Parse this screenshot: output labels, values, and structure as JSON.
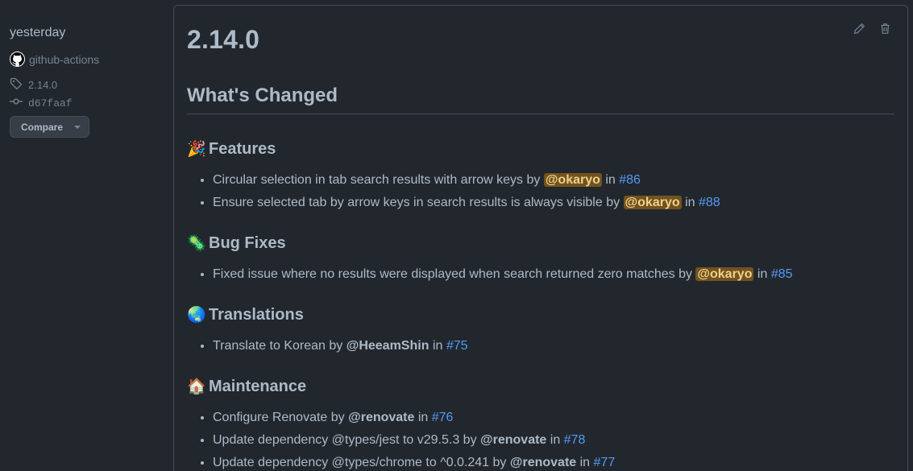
{
  "meta": {
    "date": "yesterday",
    "author": "github-actions",
    "tag": "2.14.0",
    "commit": "d67faaf",
    "compare_label": "Compare"
  },
  "release": {
    "title": "2.14.0",
    "heading": "What's Changed",
    "sections": [
      {
        "emoji": "🎉",
        "title": "Features",
        "items": [
          {
            "text": "Circular selection in tab search results with arrow keys by ",
            "user": "@okaryo",
            "highlight": true,
            "in": " in ",
            "pr": "#86"
          },
          {
            "text": "Ensure selected tab by arrow keys in search results is always visible by ",
            "user": "@okaryo",
            "highlight": true,
            "in": " in ",
            "pr": "#88"
          }
        ]
      },
      {
        "emoji": "🦠",
        "title": "Bug Fixes",
        "items": [
          {
            "text": "Fixed issue where no results were displayed when search returned zero matches by ",
            "user": "@okaryo",
            "highlight": true,
            "in": " in ",
            "pr": "#85"
          }
        ]
      },
      {
        "emoji": "🌏",
        "title": "Translations",
        "items": [
          {
            "text": "Translate to Korean by ",
            "user": "@HeeamShin",
            "highlight": false,
            "in": " in ",
            "pr": "#75"
          }
        ]
      },
      {
        "emoji": "🏠",
        "title": "Maintenance",
        "items": [
          {
            "text": "Configure Renovate by ",
            "user": "@renovate",
            "highlight": false,
            "in": " in ",
            "pr": "#76"
          },
          {
            "text": "Update dependency @types/jest to v29.5.3 by ",
            "user": "@renovate",
            "highlight": false,
            "in": " in ",
            "pr": "#78"
          },
          {
            "text": "Update dependency @types/chrome to ^0.0.241 by ",
            "user": "@renovate",
            "highlight": false,
            "in": " in ",
            "pr": "#77"
          }
        ]
      }
    ]
  },
  "icons": {
    "edit": "pencil-icon",
    "delete": "trash-icon",
    "tag": "tag-icon",
    "commit": "git-commit-icon",
    "avatar": "github-mark-icon"
  },
  "colors": {
    "background": "#22272e",
    "text": "#adbac7",
    "muted": "#768390",
    "link": "#539bf5",
    "border": "#444c56",
    "mention_highlight_bg": "#72531e"
  }
}
